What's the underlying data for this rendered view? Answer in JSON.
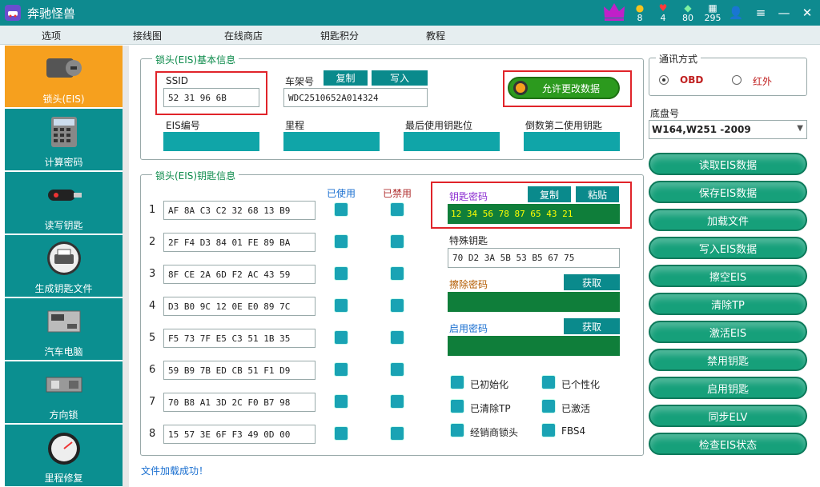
{
  "app": {
    "title": "奔驰怪兽"
  },
  "stats": {
    "coins": "8",
    "hearts": "4",
    "gems": "80",
    "db": "295"
  },
  "menu": [
    "选项",
    "接线图",
    "在线商店",
    "钥匙积分",
    "教程"
  ],
  "sidebar": [
    {
      "label": "锁头(EIS)",
      "icon": "ignition-lock-icon",
      "active": true
    },
    {
      "label": "计算密码",
      "icon": "calculator-icon"
    },
    {
      "label": "读写钥匙",
      "icon": "car-key-icon"
    },
    {
      "label": "生成钥匙文件",
      "icon": "printer-icon"
    },
    {
      "label": "汽车电脑",
      "icon": "ecu-icon"
    },
    {
      "label": "方向锁",
      "icon": "steering-lock-icon"
    },
    {
      "label": "里程修复",
      "icon": "speedometer-icon"
    }
  ],
  "basic": {
    "title": "锁头(EIS)基本信息",
    "ssid_label": "SSID",
    "ssid_value": "52 31 96 6B",
    "vin_label": "车架号",
    "copy": "复制",
    "write": "写入",
    "vin_value": "WDC2510652A014324",
    "allow_label": "允许更改数据",
    "eis_no": "EIS编号",
    "mileage": "里程",
    "last_key": "最后使用钥匙位",
    "second_last": "倒数第二使用钥匙"
  },
  "keys": {
    "title": "锁头(EIS)钥匙信息",
    "used": "已使用",
    "disabled": "已禁用",
    "rows": [
      {
        "n": "1",
        "v": "AF 8A C3 C2 32 68 13 B9"
      },
      {
        "n": "2",
        "v": "2F F4 D3 84 01 FE 89 BA"
      },
      {
        "n": "3",
        "v": "8F CE 2A 6D F2 AC 43 59"
      },
      {
        "n": "4",
        "v": "D3 B0 9C 12 0E E0 89 7C"
      },
      {
        "n": "5",
        "v": "F5 73 7F E5 C3 51 1B 35"
      },
      {
        "n": "6",
        "v": "59 B9 7B ED CB 51 F1 D9"
      },
      {
        "n": "7",
        "v": "70 B8 A1 3D 2C F0 B7 98"
      },
      {
        "n": "8",
        "v": "15 57 3E 6F F3 49 0D 00"
      }
    ],
    "key_pw_label": "钥匙密码",
    "copy": "复制",
    "paste": "粘贴",
    "key_pw": "12 34 56 78 87 65 43 21",
    "special_label": "特殊钥匙",
    "special": "70 D2 3A 5B 53 B5 67 75",
    "erase_label": "擦除密码",
    "get": "获取",
    "enable_label": "启用密码",
    "flags": [
      "已初始化",
      "已个性化",
      "已清除TP",
      "已激活",
      "经销商锁头",
      "FBS4"
    ]
  },
  "comm": {
    "title": "通讯方式",
    "obd": "OBD",
    "ir": "红外"
  },
  "chassis": {
    "label": "底盘号",
    "value": "W164,W251  -2009"
  },
  "actions": [
    "读取EIS数据",
    "保存EIS数据",
    "加载文件",
    "写入EIS数据",
    "擦空EIS",
    "清除TP",
    "激活EIS",
    "禁用钥匙",
    "启用钥匙",
    "同步ELV",
    "检查EIS状态"
  ],
  "status": "文件加载成功！",
  "colors": {
    "teal": "#0e8a8f",
    "accent": "#f6a01e",
    "green": "#0f7e3a",
    "red": "#e0242a"
  }
}
